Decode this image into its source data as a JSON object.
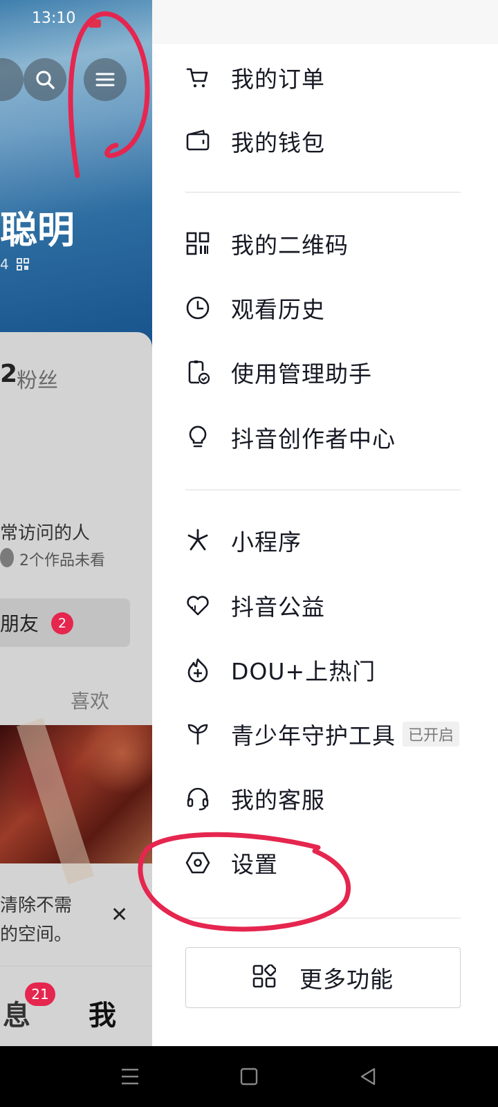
{
  "status_bar": {
    "time": "13:10"
  },
  "background_page": {
    "username_partial": "聪明",
    "id_partial": "4",
    "fans_count_partial": "2",
    "fans_label": "粉丝",
    "frequent_visitor_label": "常访问的人",
    "frequent_visitor_sub": "2个作品未看",
    "friends_label": "加朋友",
    "friends_label_partial": "朋友",
    "friends_badge": "2",
    "likes_tab": "喜欢",
    "notice_line1": "清除不需",
    "notice_line2": "的空间。",
    "tab_messages_partial": "息",
    "tab_messages_badge": "21",
    "tab_me": "我"
  },
  "drawer": {
    "groups": [
      [
        {
          "label": "我的订单",
          "icon": "cart-icon"
        },
        {
          "label": "我的钱包",
          "icon": "wallet-icon"
        }
      ],
      [
        {
          "label": "我的二维码",
          "icon": "qrcode-icon"
        },
        {
          "label": "观看历史",
          "icon": "clock-icon"
        },
        {
          "label": "使用管理助手",
          "icon": "phone-check-icon"
        },
        {
          "label": "抖音创作者中心",
          "icon": "bulb-icon"
        }
      ],
      [
        {
          "label": "小程序",
          "icon": "miniapp-icon"
        },
        {
          "label": "抖音公益",
          "icon": "heart-icon"
        },
        {
          "label": "DOU+上热门",
          "icon": "flame-plus-icon"
        },
        {
          "label": "青少年守护工具",
          "icon": "sprout-icon",
          "tag": "已开启"
        },
        {
          "label": "我的客服",
          "icon": "headset-icon"
        },
        {
          "label": "设置",
          "icon": "hexagon-settings-icon"
        }
      ]
    ],
    "more_button": {
      "label": "更多功能",
      "icon": "grid-icon"
    }
  },
  "colors": {
    "annotation": "#e5264f",
    "badge": "#e5264f",
    "text": "#161823"
  }
}
